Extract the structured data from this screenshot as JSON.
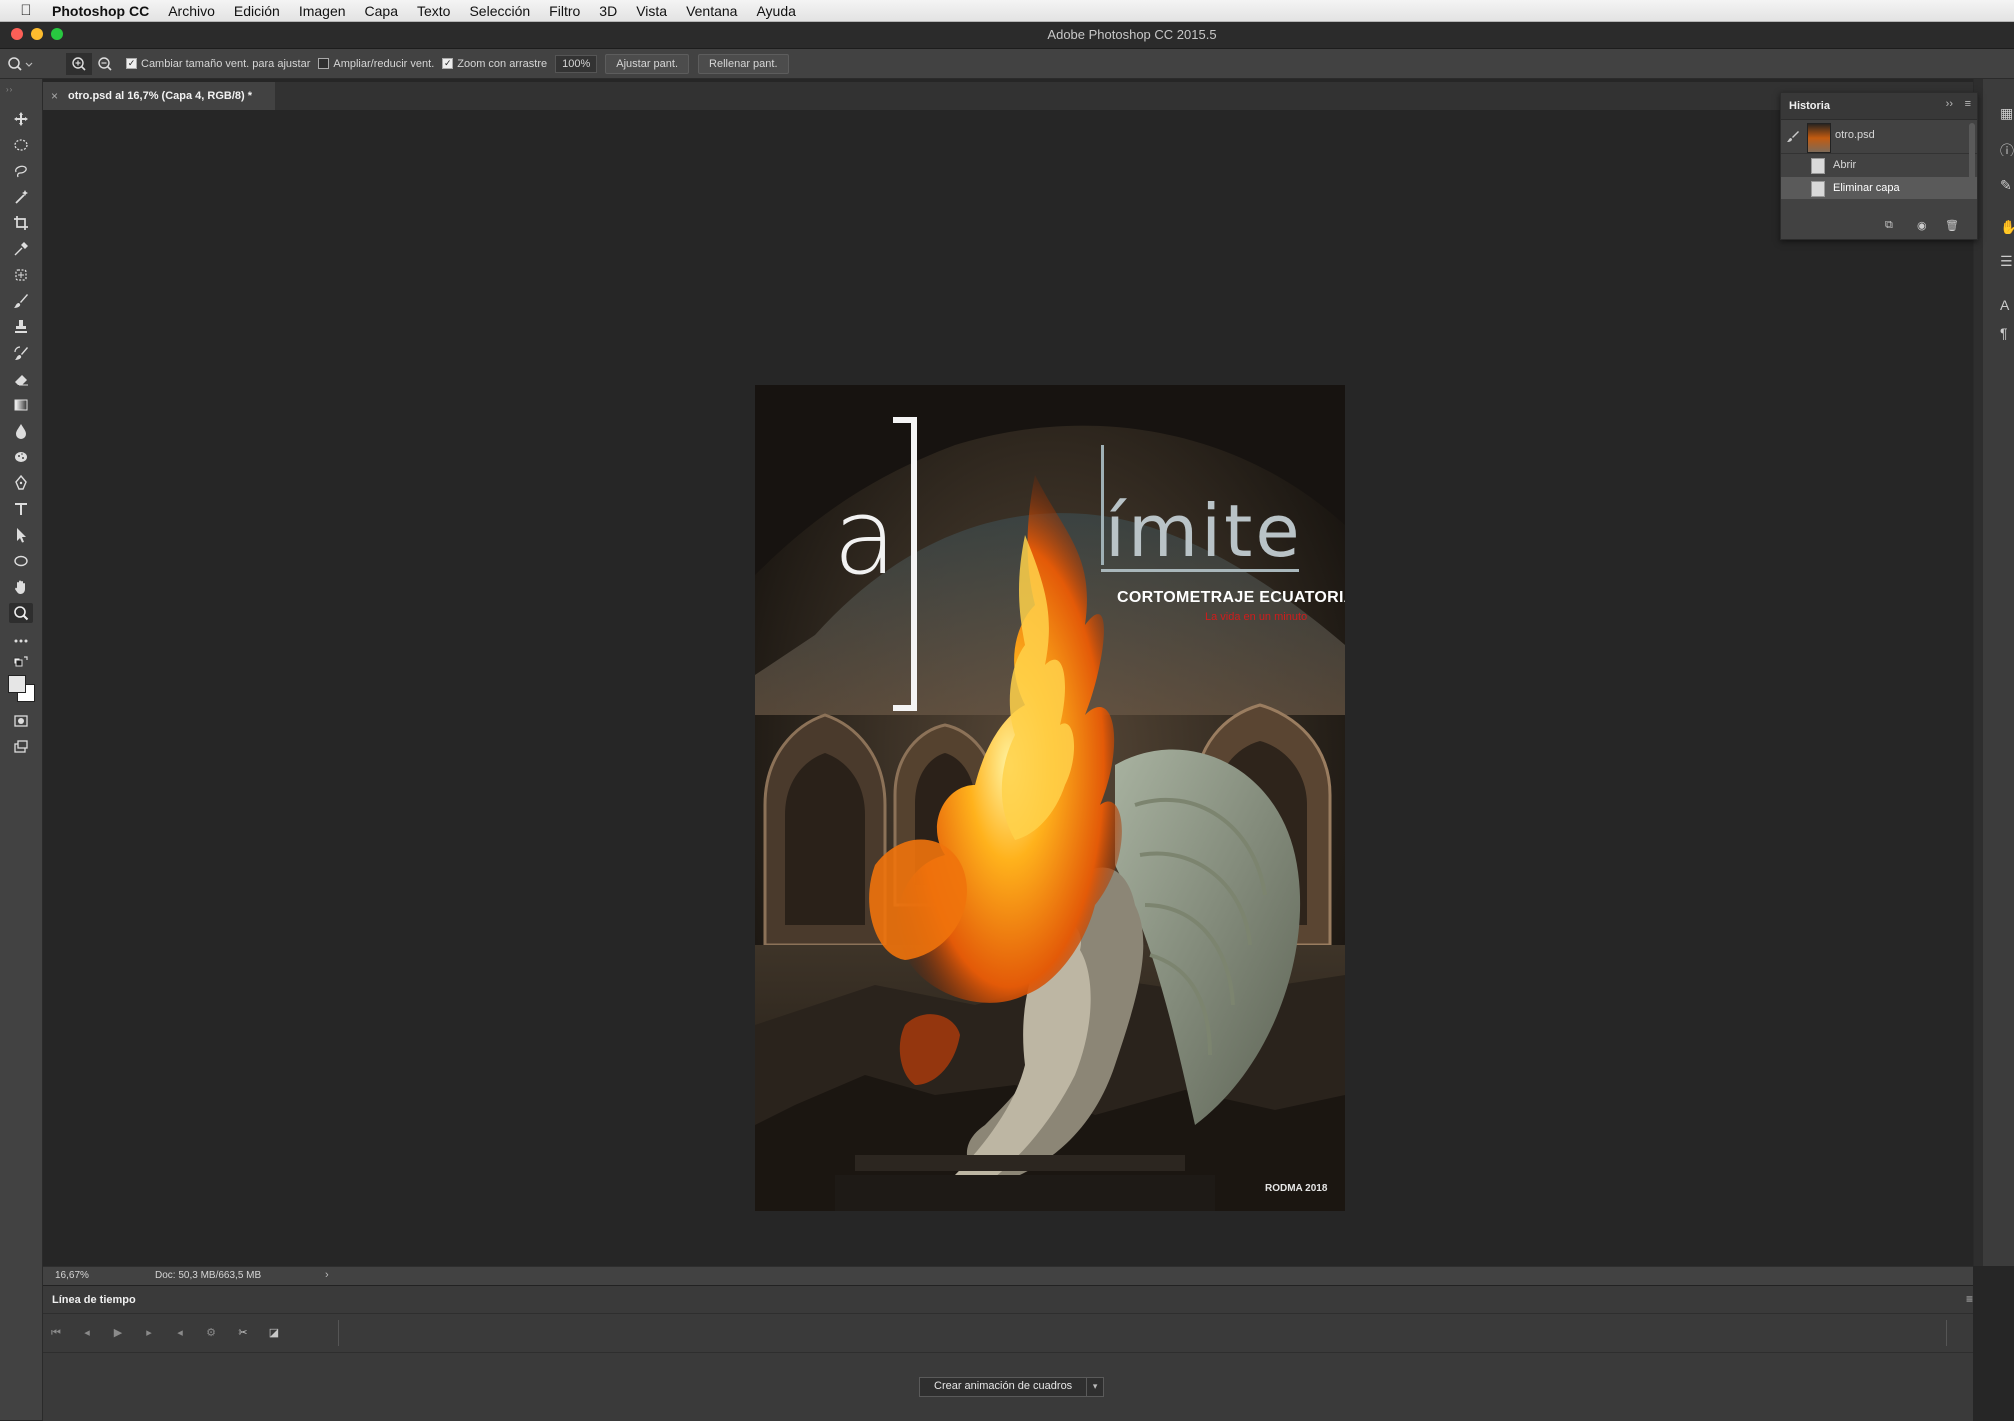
{
  "menubar": {
    "apple": "",
    "items": [
      "Photoshop CC",
      "Archivo",
      "Edición",
      "Imagen",
      "Capa",
      "Texto",
      "Selección",
      "Filtro",
      "3D",
      "Vista",
      "Ventana",
      "Ayuda"
    ]
  },
  "window": {
    "title": "Adobe Photoshop CC 2015.5"
  },
  "options": {
    "resize_windows": "Cambiar tamaño vent. para ajustar",
    "zoom_all_windows": "Ampliar/reducir vent.",
    "scrubby_zoom": "Zoom con arrastre",
    "zoom_value": "100%",
    "fit_screen": "Ajustar pant.",
    "fill_screen": "Rellenar pant."
  },
  "document": {
    "tab_title": "otro.psd al 16,7% (Capa 4, RGB/8) *"
  },
  "poster": {
    "word_a": "a",
    "word_limite": "ímite",
    "subtitle": "CORTOMETRAJE ECUATORIANO",
    "tagline": "La vida en un minuto",
    "credit": "RODMA 2018"
  },
  "history": {
    "title": "Historia",
    "snapshot": "otro.psd",
    "steps": [
      "Abrir",
      "Eliminar capa"
    ]
  },
  "status": {
    "zoom": "16,67%",
    "doc": "Doc: 50,3 MB/663,5 MB"
  },
  "timeline": {
    "title": "Línea de tiempo",
    "create_button": "Crear animación de cuadros"
  },
  "colors": {
    "foreground": "#e6e6e6",
    "background": "#ffffff",
    "accent_fire": "#f08a12",
    "poster_red": "#d01c1c"
  }
}
